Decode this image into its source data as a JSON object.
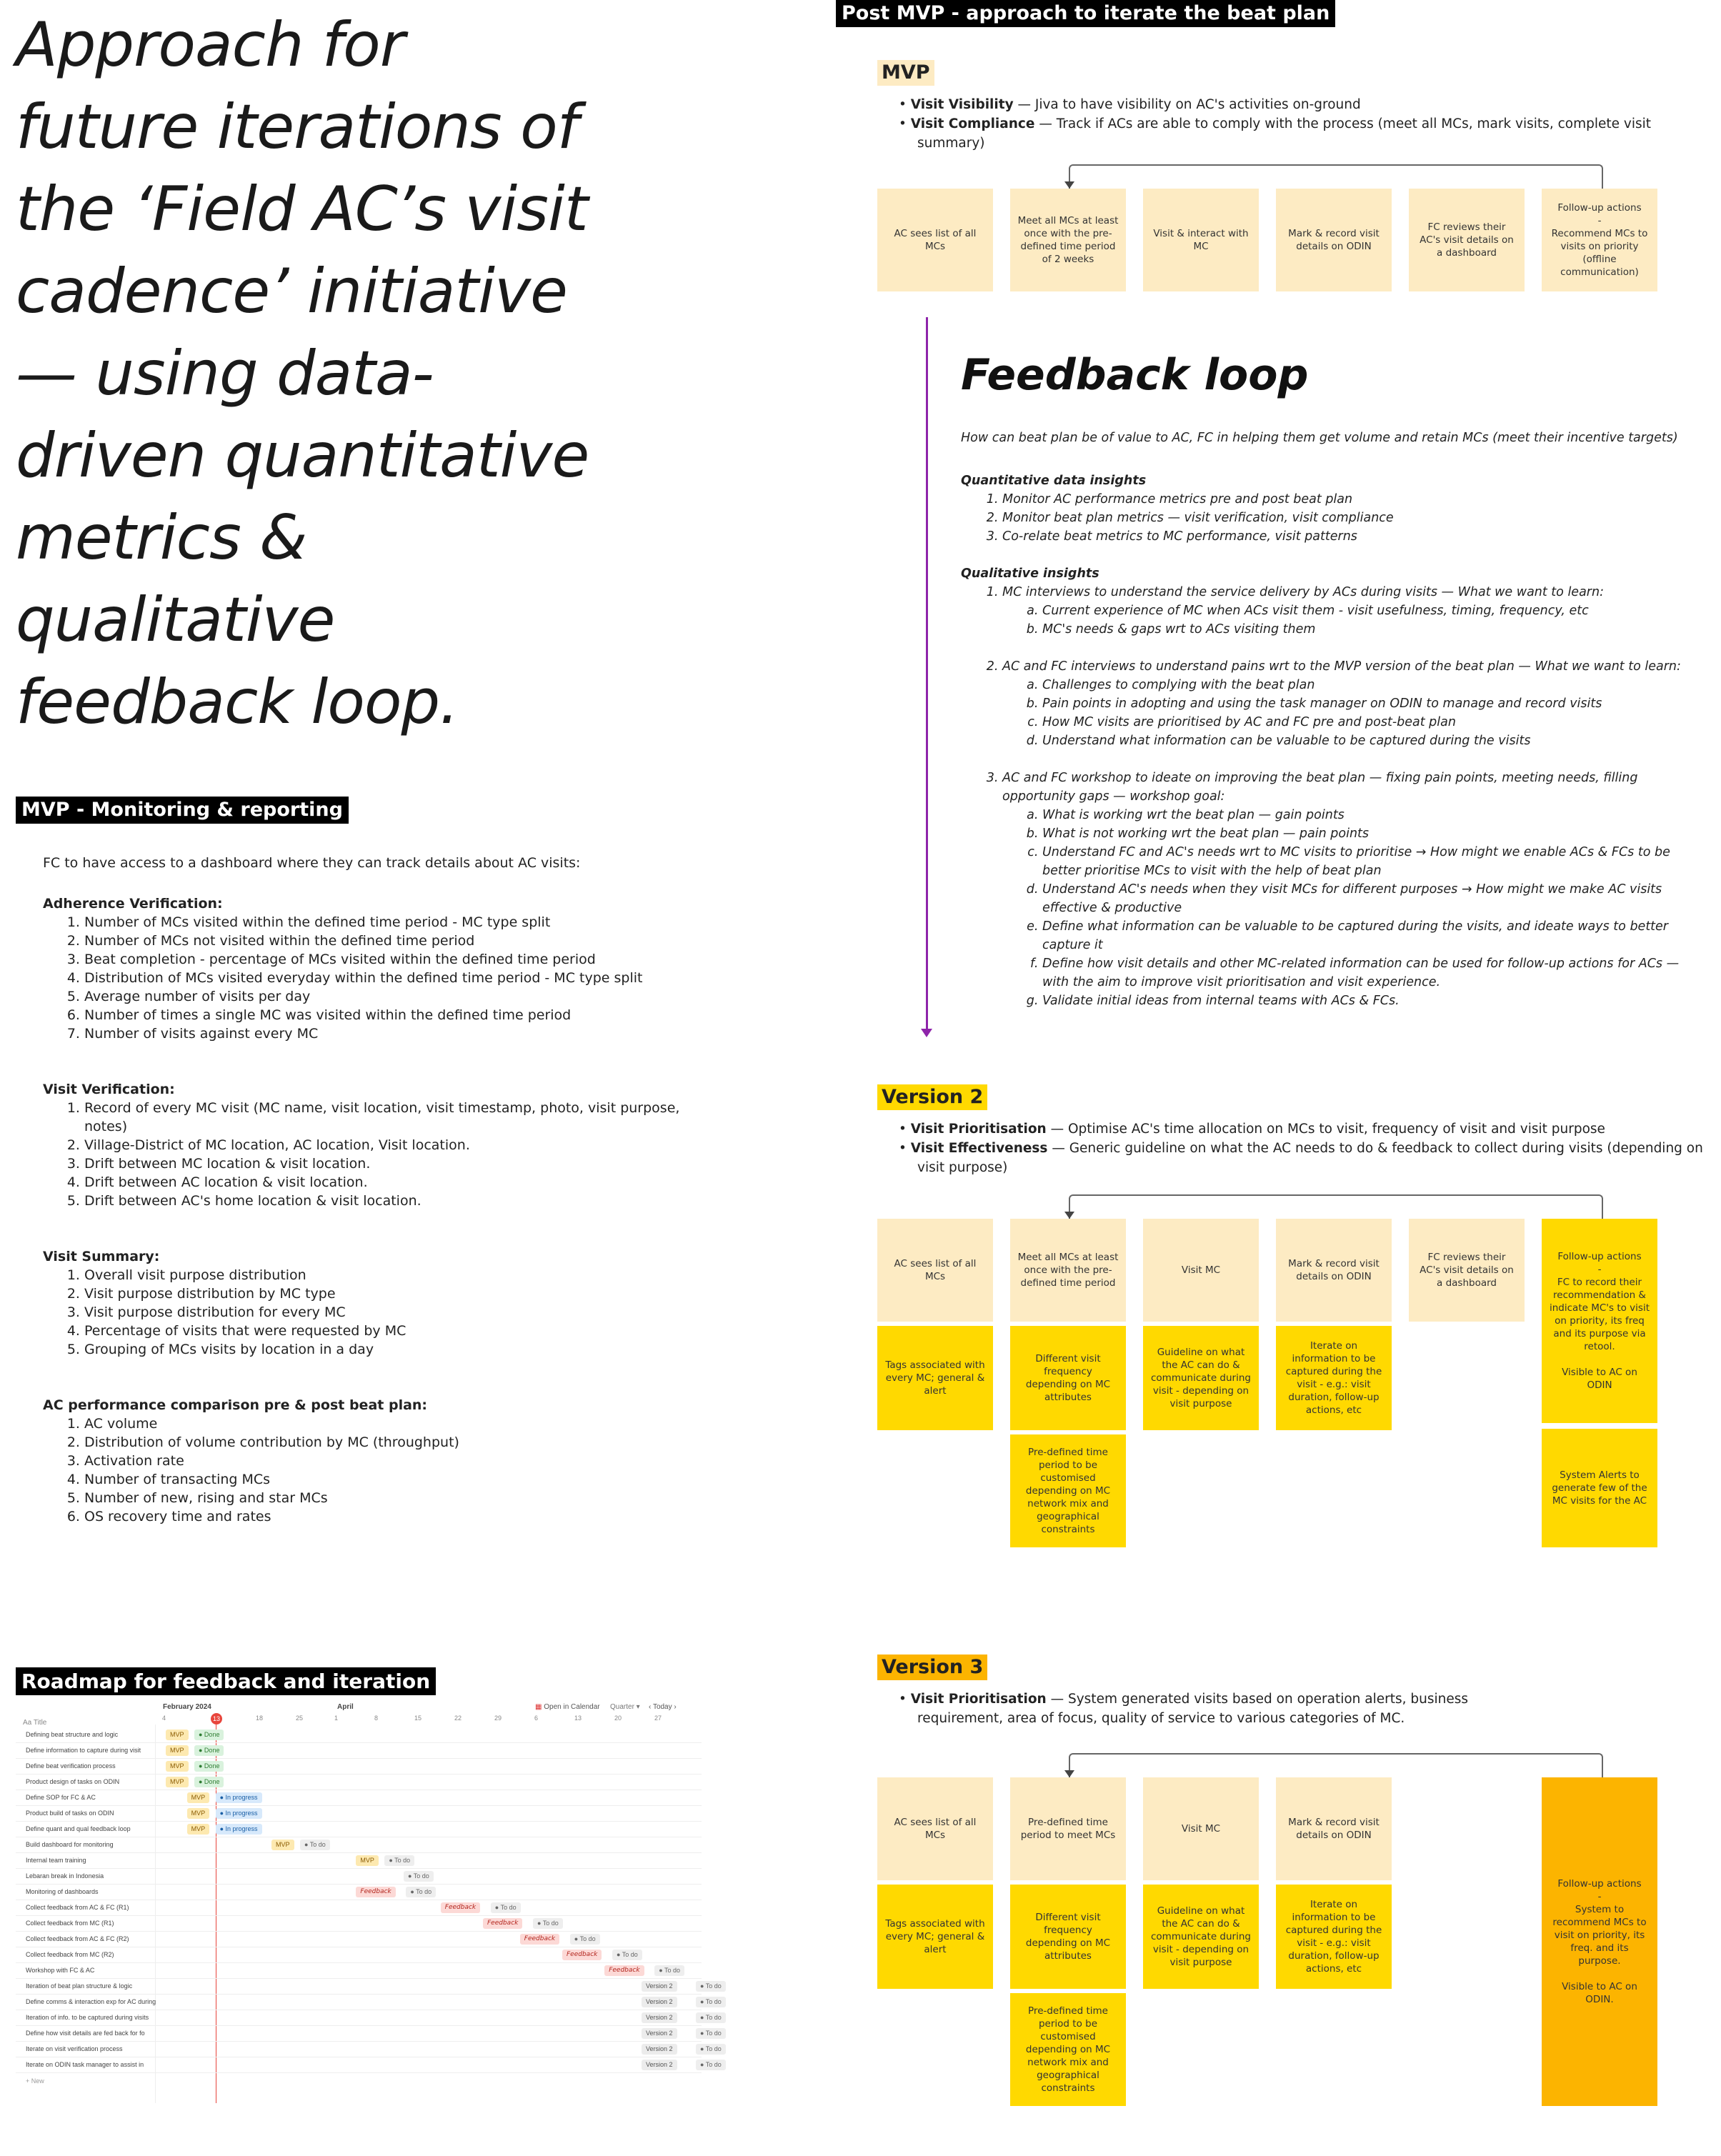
{
  "hero": {
    "title": "Approach for future iterations of the ‘Field AC’s visit cadence’ initiative — using data-driven quantitative metrics & qualitative feedback loop."
  },
  "monitoring": {
    "header": "MVP - Monitoring & reporting",
    "intro": "FC to have access to a dashboard where they can track details about AC visits:",
    "sections": [
      {
        "title": "Adherence Verification:",
        "items": [
          "Number of MCs visited within the defined time period - MC type split",
          "Number of MCs not visited within the defined time period",
          "Beat completion - percentage of MCs visited within the defined time period",
          "Distribution of MCs visited everyday within the defined time period - MC type split",
          "Average number of visits per day",
          "Number of times a single MC was visited within the defined time period",
          "Number of visits against every MC"
        ]
      },
      {
        "title": "Visit Verification:",
        "items": [
          "Record of every MC visit (MC name, visit location, visit timestamp, photo, visit purpose, notes)",
          "Village-District of MC location, AC location, Visit location.",
          "Drift between MC location & visit location.",
          "Drift between AC location & visit location.",
          "Drift between AC's home location & visit location."
        ]
      },
      {
        "title": "Visit Summary:",
        "items": [
          "Overall visit purpose distribution",
          "Visit purpose distribution by MC type",
          "Visit purpose distribution for every MC",
          "Percentage of visits that were requested by MC",
          "Grouping of MCs visits by location in a day"
        ]
      },
      {
        "title": "AC performance comparison pre & post beat plan:",
        "items": [
          "AC volume",
          "Distribution of volume contribution by MC (throughput)",
          "Activation rate",
          "Number of transacting MCs",
          "Number of new, rising and star MCs",
          "OS recovery time and rates"
        ]
      }
    ]
  },
  "post": {
    "header": "Post MVP - approach to iterate the beat plan",
    "mvp": {
      "tag": "MVP",
      "bullets": [
        {
          "b": "Visit Visibility",
          "t": " — Jiva to have visibility on AC's activities on-ground"
        },
        {
          "b": "Visit Compliance",
          "t": " — Track if ACs are able to comply with the process (meet all MCs, mark visits, complete visit summary)"
        }
      ],
      "stickies": [
        "AC sees list of all MCs",
        "Meet all MCs at least once with the pre-defined time period of 2 weeks",
        "Visit & interact with MC",
        "Mark & record visit details on ODIN",
        "FC reviews their AC's visit details on a dashboard",
        "Follow-up actions\n-\nRecommend MCs to visits on priority\n(offline communication)"
      ]
    },
    "feedback": {
      "title": "Feedback loop",
      "question": "How can beat plan be of value to AC, FC in helping them get volume and retain MCs (meet their incentive targets)",
      "quant_title": "Quantitative data insights",
      "quant": [
        "Monitor AC performance metrics pre and post beat plan",
        "Monitor beat plan metrics — visit verification, visit compliance",
        "Co-relate beat metrics to MC performance, visit patterns"
      ],
      "qual_title": "Qualitative insights",
      "qual": [
        {
          "t": "MC interviews to understand the service delivery by ACs during visits — What we want to learn:",
          "sub": [
            "Current experience of MC when ACs visit them - visit usefulness, timing, frequency, etc",
            "MC's needs & gaps wrt to ACs visiting them"
          ]
        },
        {
          "t": "AC and FC interviews to understand pains wrt to the MVP version of the beat plan — What we want to learn:",
          "sub": [
            "Challenges to complying with the beat plan",
            "Pain points in adopting and using the task manager on ODIN to manage and record visits",
            "How MC visits are prioritised by AC and FC pre and post-beat plan",
            "Understand what information can be valuable to be captured during the visits"
          ]
        },
        {
          "t": "AC and FC workshop to ideate on improving the beat plan — fixing pain points, meeting needs, filling opportunity gaps — workshop goal:",
          "sub": [
            "What is working wrt the beat plan — gain points",
            "What is not working wrt the beat plan — pain points",
            "Understand FC and AC's needs wrt to MC visits to prioritise → How might we enable ACs & FCs to be better prioritise MCs to visit with the help of beat plan",
            "Understand AC's needs when they visit MCs for different purposes → How might we make AC visits effective & productive",
            "Define what information can be valuable to be captured during the visits, and ideate ways to better capture it",
            "Define how visit details and other MC-related information can be used for follow-up actions for ACs — with the aim to improve visit prioritisation and visit experience.",
            "Validate initial ideas from internal teams with ACs & FCs."
          ]
        }
      ]
    },
    "v2": {
      "tag": "Version 2",
      "bullets": [
        {
          "b": "Visit Prioritisation",
          "t": " — Optimise AC's time allocation on MCs to visit, frequency of visit and visit purpose"
        },
        {
          "b": "Visit Effectiveness",
          "t": " — Generic guideline on what the AC needs to do & feedback to collect during visits (depending on visit purpose)"
        }
      ],
      "row1": [
        "AC sees list of all MCs",
        "Meet all MCs at least once with the pre-defined time period",
        "Visit MC",
        "Mark & record visit details on ODIN",
        "FC reviews their AC's visit details on a dashboard"
      ],
      "followup": "Follow-up actions\n-\nFC to record their recommendation & indicate MC's to visit on priority, its freq and its purpose via retool.\n\nVisible to AC on ODIN",
      "row2": [
        "Tags associated with every MC; general & alert",
        "Different visit frequency depending on MC attributes",
        "Guideline on what the AC can do & communicate during visit - depending on visit purpose",
        "Iterate on information to be captured during the visit - e.g.: visit duration, follow-up actions, etc"
      ],
      "row3": "Pre-defined time period to be customised depending on MC network mix and geographical constraints",
      "alerts": "System Alerts to generate few of the MC visits for the AC"
    },
    "v3": {
      "tag": "Version 3",
      "bullets": [
        {
          "b": "Visit Prioritisation",
          "t": " — System generated visits based on operation alerts, business requirement, area of focus, quality of service to various categories of MC."
        }
      ],
      "row1": [
        "AC sees list of all MCs",
        "Pre-defined time period to meet MCs",
        "Visit MC",
        "Mark & record visit details on ODIN"
      ],
      "row2": [
        "Tags associated with every MC; general & alert",
        "Different visit frequency depending on MC attributes",
        "Guideline on what the AC can do & communicate during visit - depending on visit purpose",
        "Iterate on information to be captured during the visit - e.g.: visit duration, follow-up actions, etc"
      ],
      "row3": "Pre-defined time period to be customised depending on MC network mix and geographical constraints",
      "followup": "Follow-up actions\n-\nSystem to recommend MCs to visit on priority, its freq. and its purpose.\n\nVisible to AC on ODIN."
    }
  },
  "roadmap": {
    "header": "Roadmap for feedback and iteration",
    "month1": "February 2024",
    "month2": "April",
    "today_day": "13",
    "open_calendar": "Open in Calendar",
    "quarter": "Quarter",
    "today": "Today",
    "col_title": "Aa Title",
    "days": [
      "4",
      "13",
      "18",
      "25",
      "1",
      "8",
      "15",
      "22",
      "29",
      "6",
      "13",
      "20",
      "27"
    ],
    "new_label": "+ New",
    "rows": [
      {
        "t": "Defining beat structure and logic",
        "tag": "MVP",
        "status": "Done",
        "c": "mvp",
        "s": "done",
        "x": 0.0
      },
      {
        "t": "Define information to capture during visit",
        "tag": "MVP",
        "status": "Done",
        "c": "mvp",
        "s": "done",
        "x": 0.0
      },
      {
        "t": "Define beat verification process",
        "tag": "MVP",
        "status": "Done",
        "c": "mvp",
        "s": "done",
        "x": 0.0
      },
      {
        "t": "Product design of tasks on ODIN",
        "tag": "MVP",
        "status": "Done",
        "c": "mvp",
        "s": "done",
        "x": 0.0
      },
      {
        "t": "Define SOP for FC & AC",
        "tag": "MVP",
        "status": "In progress",
        "c": "mvp",
        "s": "prog",
        "x": 0.04
      },
      {
        "t": "Product build of tasks on ODIN",
        "tag": "MVP",
        "status": "In progress",
        "c": "mvp",
        "s": "prog",
        "x": 0.04
      },
      {
        "t": "Define quant and qual feedback loop",
        "tag": "MVP",
        "status": "In progress",
        "c": "mvp",
        "s": "prog",
        "x": 0.04
      },
      {
        "t": "Build dashboard for monitoring",
        "tag": "MVP",
        "status": "To do",
        "c": "mvp",
        "s": "st",
        "x": 0.2
      },
      {
        "t": "Internal team training",
        "tag": "MVP",
        "status": "To do",
        "c": "mvp",
        "s": "st",
        "x": 0.36
      },
      {
        "t": "Lebaran break in Indonesia",
        "tag": "",
        "status": "To do",
        "c": "",
        "s": "st",
        "x": 0.45
      },
      {
        "t": "Monitoring of dashboards",
        "tag": "Feedback",
        "status": "To do",
        "c": "fb",
        "s": "st",
        "x": 0.36
      },
      {
        "t": "Collect feedback from AC & FC (R1)",
        "tag": "Feedback",
        "status": "To do",
        "c": "fb",
        "s": "st",
        "x": 0.52
      },
      {
        "t": "Collect feedback from MC (R1)",
        "tag": "Feedback",
        "status": "To do",
        "c": "fb",
        "s": "st",
        "x": 0.6
      },
      {
        "t": "Collect feedback from AC & FC (R2)",
        "tag": "Feedback",
        "status": "To do",
        "c": "fb",
        "s": "st",
        "x": 0.67
      },
      {
        "t": "Collect feedback from MC (R2)",
        "tag": "Feedback",
        "status": "To do",
        "c": "fb",
        "s": "st",
        "x": 0.75
      },
      {
        "t": "Workshop with FC & AC",
        "tag": "Feedback",
        "status": "To do",
        "c": "fb",
        "s": "st",
        "x": 0.83
      },
      {
        "t": "Iteration of beat plan structure & logic",
        "tag": "Version 2",
        "status": "To do",
        "c": "v2",
        "s": "st",
        "x": 0.9
      },
      {
        "t": "Define comms & interaction exp for AC during",
        "tag": "Version 2",
        "status": "To do",
        "c": "v2",
        "s": "st",
        "x": 0.9
      },
      {
        "t": "Iteration of info. to be captured during visits",
        "tag": "Version 2",
        "status": "To do",
        "c": "v2",
        "s": "st",
        "x": 0.9
      },
      {
        "t": "Define how visit details are fed back for fo",
        "tag": "Version 2",
        "status": "To do",
        "c": "v2",
        "s": "st",
        "x": 0.9
      },
      {
        "t": "Iterate on visit verification process",
        "tag": "Version 2",
        "status": "To do",
        "c": "v2",
        "s": "st",
        "x": 0.9
      },
      {
        "t": "Iterate on ODIN task manager to assist in",
        "tag": "Version 2",
        "status": "To do",
        "c": "v2",
        "s": "st",
        "x": 0.9
      }
    ]
  },
  "colors": {
    "light": "#fdebc3",
    "yellow": "#ffd900",
    "orange": "#fcb400",
    "arrow": "#8e24aa"
  }
}
